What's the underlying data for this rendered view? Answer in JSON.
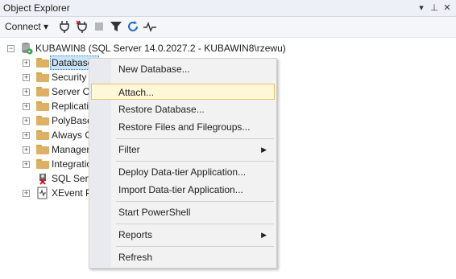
{
  "panel": {
    "title": "Object Explorer",
    "buttons": {
      "dropdown": "▾",
      "pin": "⊥",
      "close": "✕"
    }
  },
  "toolbar": {
    "connect_label": "Connect ▾",
    "icons": [
      "connect-server-icon",
      "disconnect-icon",
      "stop-icon",
      "filter-icon",
      "refresh-icon",
      "activity-monitor-icon"
    ]
  },
  "tree": {
    "server": "KUBAWIN8 (SQL Server 14.0.2027.2 - KUBAWIN8\\rzewu)",
    "children": [
      "Databases",
      "Security",
      "Server Ob",
      "Replicatio",
      "PolyBase",
      "Always O",
      "Managen",
      "Integratio",
      "SQL Serv",
      "XEvent P"
    ]
  },
  "context_menu": {
    "items": [
      {
        "label": "New Database..."
      },
      {
        "label": "Attach..."
      },
      {
        "label": "Restore Database..."
      },
      {
        "label": "Restore Files and Filegroups..."
      },
      {
        "label": "Filter",
        "arrow": "▶"
      },
      {
        "label": "Deploy Data-tier Application..."
      },
      {
        "label": "Import Data-tier Application..."
      },
      {
        "label": "Start PowerShell"
      },
      {
        "label": "Reports",
        "arrow": "▶"
      },
      {
        "label": "Refresh"
      }
    ]
  },
  "colors": {
    "selection": "#cce4f7",
    "menu_hover": "#fff8d8",
    "folder": "#dcb067"
  }
}
